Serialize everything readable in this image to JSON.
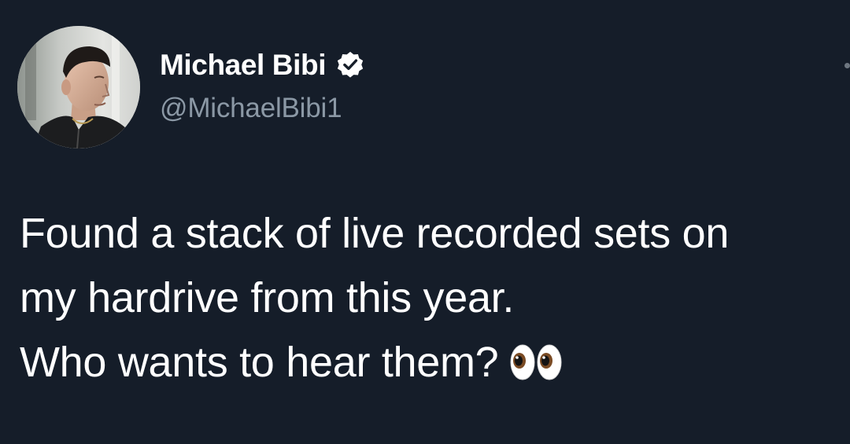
{
  "theme": {
    "background": "#151d29",
    "text_primary": "#ffffff",
    "text_secondary": "#8b98a5",
    "verified_badge": "#ffffff"
  },
  "author": {
    "display_name": "Michael Bibi",
    "handle": "@MichaelBibi1",
    "verified": true,
    "verified_icon": "verified-badge-icon",
    "avatar": "profile-photo"
  },
  "tweet": {
    "lines": [
      "Found a stack of live recorded sets on",
      "my hardrive from this year.",
      "Who wants to hear them?"
    ],
    "trailing_emoji": "eyes-emoji"
  },
  "more_menu_icon": "more-options-icon"
}
